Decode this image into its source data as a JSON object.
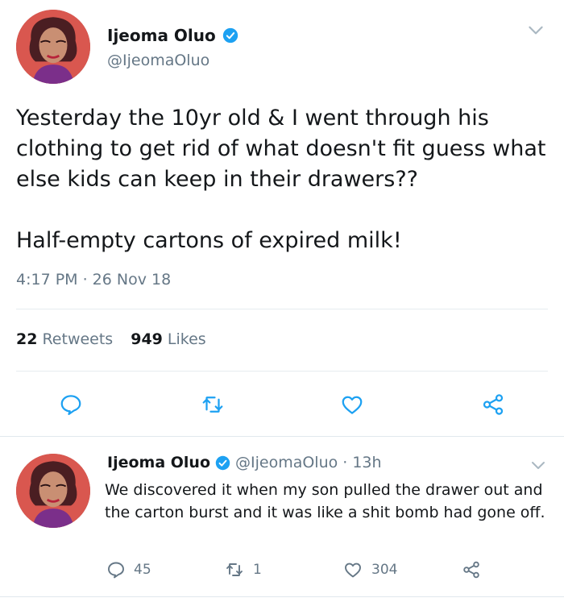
{
  "colors": {
    "accent": "#1da1f2",
    "muted": "#657786",
    "text": "#14171a",
    "divider": "#e6ecf0"
  },
  "tweet": {
    "author_name": "Ijeoma Oluo",
    "author_handle": "@IjeomaOluo",
    "verified_icon": "verified-badge-icon",
    "text_p1": "Yesterday the 10yr old & I went through his clothing to get rid of what doesn't fit guess what else kids can keep in their drawers??",
    "text_p2": "Half-empty cartons of expired milk!",
    "timestamp": "4:17 PM · 26 Nov 18",
    "retweet_count": "22",
    "retweet_label": "Retweets",
    "like_count": "949",
    "like_label": "Likes",
    "actions": [
      "reply-icon",
      "retweet-icon",
      "like-icon",
      "share-icon"
    ]
  },
  "reply": {
    "author_name": "Ijeoma Oluo",
    "author_handle": "@IjeomaOluo",
    "time": "· 13h",
    "text": "We discovered it when my son pulled the drawer out and the carton burst and it was like a shit bomb had gone off.",
    "reply_count": "45",
    "retweet_count": "1",
    "like_count": "304"
  }
}
